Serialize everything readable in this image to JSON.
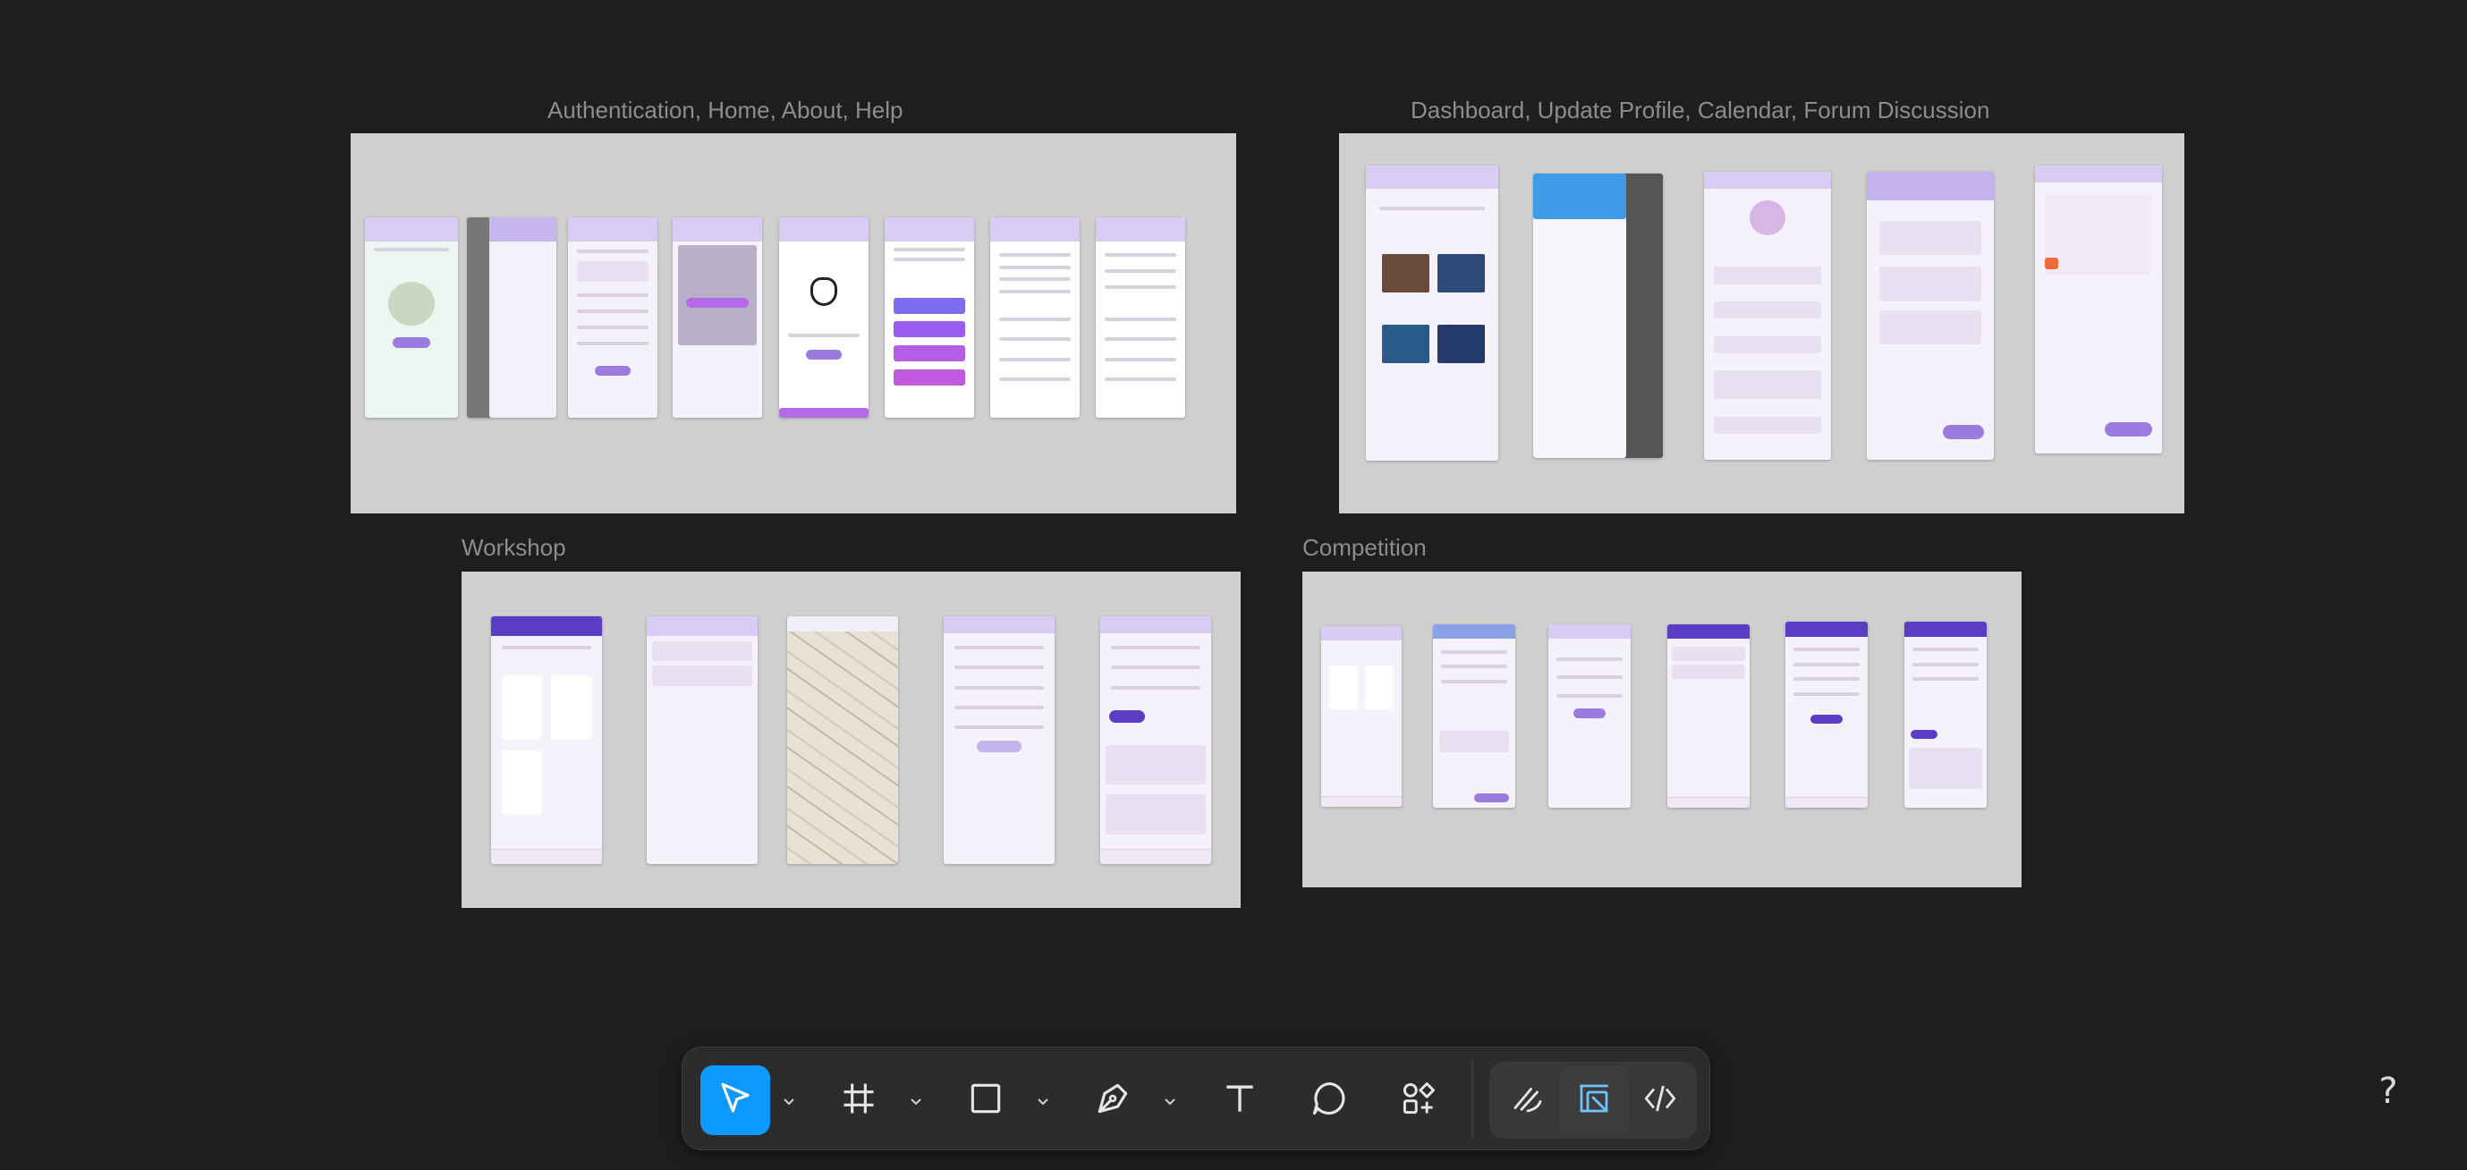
{
  "canvas": {
    "sections": [
      {
        "id": "auth",
        "title": "Authentication, Home, About, Help"
      },
      {
        "id": "dashboard",
        "title": "Dashboard, Update Profile, Calendar, Forum Discussion"
      },
      {
        "id": "workshop",
        "title": "Workshop"
      },
      {
        "id": "competition",
        "title": "Competition"
      }
    ]
  },
  "toolbar": {
    "tools": [
      {
        "name": "move-tool",
        "icon": "pointer-arrow-icon",
        "active": true
      },
      {
        "name": "frame-tool",
        "icon": "frame-hash-icon"
      },
      {
        "name": "shape-tool",
        "icon": "rectangle-icon"
      },
      {
        "name": "pen-tool",
        "icon": "pen-nib-icon"
      },
      {
        "name": "text-tool",
        "icon": "text-t-icon"
      },
      {
        "name": "comment-tool",
        "icon": "comment-bubble-icon"
      },
      {
        "name": "actions-tool",
        "icon": "shapes-plus-icon"
      }
    ],
    "modes": [
      {
        "name": "draw-mode",
        "icon": "draw-squiggle-icon"
      },
      {
        "name": "design-mode",
        "icon": "layout-design-icon",
        "selected": true
      },
      {
        "name": "dev-mode",
        "icon": "code-brackets-icon"
      }
    ]
  },
  "help": {
    "label": "?"
  },
  "colors": {
    "canvas_bg": "#1e1e1e",
    "section_bg": "#cfcfcf",
    "accent": "#0d99ff",
    "app_purple": "#5b3cc4"
  }
}
